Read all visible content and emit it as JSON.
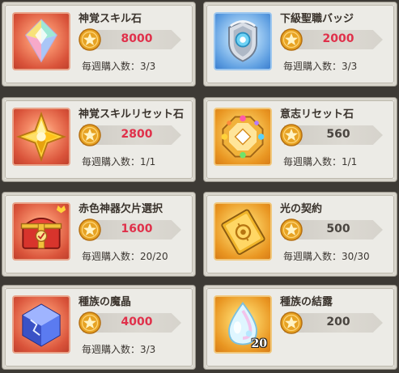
{
  "shop_items": [
    {
      "name": "神覚スキル石",
      "price": "8000",
      "price_affordable": false,
      "limit_label": "毎週購入数：3/3",
      "icon": "prismatic-crystal-icon",
      "tile_color": "red"
    },
    {
      "name": "下級聖職バッジ",
      "price": "2000",
      "price_affordable": false,
      "limit_label": "毎週購入数：3/3",
      "icon": "silver-crest-badge-icon",
      "tile_color": "blue"
    },
    {
      "name": "神覚スキルリセット石",
      "price": "2800",
      "price_affordable": false,
      "limit_label": "毎週購入数：1/1",
      "icon": "gold-cross-gem-icon",
      "tile_color": "red"
    },
    {
      "name": "意志リセット石",
      "price": "560",
      "price_affordable": true,
      "limit_label": "毎週購入数：1/1",
      "icon": "jeweled-octagon-icon",
      "tile_color": "gold"
    },
    {
      "name": "赤色神器欠片選択",
      "price": "1600",
      "price_affordable": false,
      "limit_label": "毎週購入数：20/20",
      "icon": "red-treasure-chest-icon",
      "tile_color": "red"
    },
    {
      "name": "光の契約",
      "price": "500",
      "price_affordable": true,
      "limit_label": "毎週購入数：30/30",
      "icon": "golden-tome-icon",
      "tile_color": "gold"
    },
    {
      "name": "種族の魔晶",
      "price": "4000",
      "price_affordable": false,
      "limit_label": "毎週購入数：3/3",
      "icon": "blue-cube-crystal-icon",
      "tile_color": "red"
    },
    {
      "name": "種族の結露",
      "price": "200",
      "price_affordable": true,
      "limit_label": "",
      "icon": "dewdrop-icon",
      "tile_color": "gold",
      "quantity_badge": "20"
    }
  ],
  "colors": {
    "price_unaffordable": "#e0304a",
    "price_affordable": "#4a4540",
    "coin_gold": "#e7a323"
  }
}
